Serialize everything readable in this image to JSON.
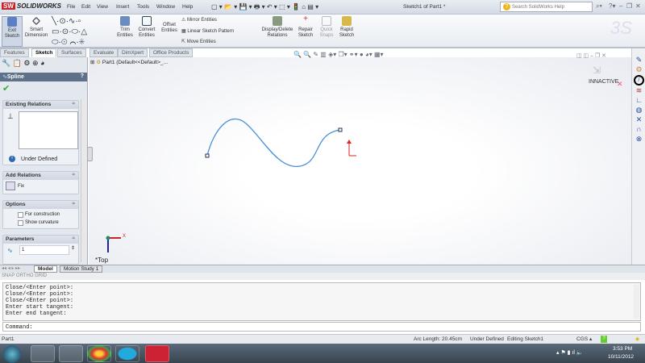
{
  "app": {
    "brand": "SOLIDWORKS",
    "menus": [
      "File",
      "Edit",
      "View",
      "Insert",
      "Tools",
      "Window",
      "Help"
    ],
    "document_title": "Sketch1 of Part1 *",
    "search_placeholder": "Search SolidWorks Help"
  },
  "ribbon": {
    "exit_sketch": "Exit Sketch",
    "smart_dimension": "Smart Dimension",
    "trim": "Trim Entities",
    "convert": "Convert Entities",
    "offset": "Offset Entities",
    "mirror": "Mirror Entities",
    "linear_pattern": "Linear Sketch Pattern",
    "move": "Move Entities",
    "display_delete": "Display/Delete Relations",
    "repair": "Repair Sketch",
    "quick_snaps": "Quick Snaps",
    "rapid_sketch": "Rapid Sketch"
  },
  "tabs": [
    "Features",
    "Sketch",
    "Surfaces",
    "Evaluate",
    "DimXpert",
    "Office Products"
  ],
  "property_manager": {
    "title": "Spline",
    "help": "?",
    "existing_relations": "Existing Relations",
    "status": "Under Defined",
    "add_relations": "Add Relations",
    "fix": "Fix",
    "options": "Options",
    "for_construction": "For construction",
    "show_curvature": "Show curvature",
    "parameters": "Parameters",
    "param_value": "1"
  },
  "tree": {
    "root": "Part1 (Default<<Default>_..."
  },
  "viewport": {
    "view_label": "*Top",
    "axis_x": "X",
    "annotation": "INNACTIVE",
    "spline_color": "#4a90d9"
  },
  "bottom_tabs": [
    "Model",
    "Motion Study 1"
  ],
  "snap_row": "SNAP  ORTHO  GRID",
  "command_history": [
    "Close/<Enter point>:",
    "Close/<Enter point>:",
    "Close/<Enter point>:",
    "Enter start tangent:",
    "Enter end tangent:"
  ],
  "command_prompt": "Command:",
  "status": {
    "left": "Part1",
    "arc_length": "Arc Length: 20.45cm",
    "defined": "Under Defined",
    "editing": "Editing Sketch1",
    "units": "CGS"
  },
  "taskbar": {
    "time": "3:53 PM",
    "date": "10/11/2012"
  }
}
